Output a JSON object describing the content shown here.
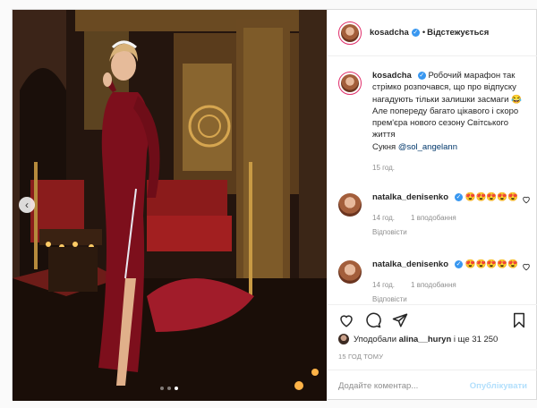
{
  "post": {
    "author": {
      "username": "kosadcha",
      "verified": true,
      "follow_status": "Відстежується",
      "separator": "•"
    },
    "carousel": {
      "slides_count": 3,
      "active_slide": 3,
      "prev_icon": "chevron-left-icon"
    },
    "caption": {
      "username": "kosadcha",
      "text": "Робочий марафон так стрімко розпочався, що про відпуску нагадують тільки залишки засмаги 😂 Але попереду багато цікавого і скоро прем'єра нового сезону Світського життя",
      "credit_prefix": "Сукня",
      "mention": "@sol_angelann",
      "time": "15 год."
    },
    "comments": [
      {
        "username": "natalka_denisenko",
        "verified": true,
        "text": "😍😍😍😍😍",
        "time": "14 год.",
        "likes": "1 вподобання",
        "reply": "Відповісти"
      },
      {
        "username": "natalka_denisenko",
        "verified": true,
        "text": "😍😍😍😍😍",
        "time": "14 год.",
        "likes": "1 вподобання",
        "reply": "Відповісти"
      }
    ],
    "likes": {
      "prefix": "Уподобали",
      "user": "alina__huryn",
      "suffix": "і ще 31 250"
    },
    "timestamp": "15 ГОД ТОМУ",
    "comment_box": {
      "placeholder": "Додайте коментар...",
      "publish_label": "Опублікувати"
    },
    "colors": {
      "accent_blue": "#3897f0",
      "publish_disabled": "#b2dffc",
      "secondary_text": "#8e8e8e",
      "dress_red": "#7d0f1c"
    }
  }
}
